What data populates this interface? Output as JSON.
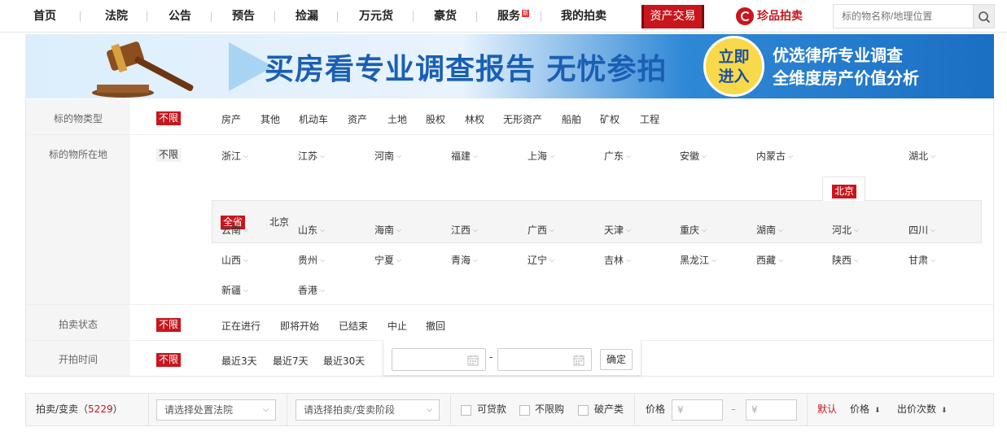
{
  "nav": {
    "items": [
      "首页",
      "法院",
      "公告",
      "预告",
      "捡漏",
      "万元货",
      "豪货",
      "服务",
      "我的拍卖"
    ],
    "hot_badge": "新",
    "asset_trade": "资产交易",
    "brand": "珍品拍卖",
    "search_placeholder": "标的物名称/地理位置"
  },
  "banner": {
    "main_text": "买房看专业调查报告 无忧参拍",
    "cta_line1": "立即",
    "cta_line2": "进入",
    "right_line1": "优选律所专业调查",
    "right_line2": "全维度房产价值分析"
  },
  "filters": {
    "unlimited_label": "不限",
    "type": {
      "label": "标的物类型",
      "options": [
        "房产",
        "其他",
        "机动车",
        "资产",
        "土地",
        "股权",
        "林权",
        "无形资产",
        "船舶",
        "矿权",
        "工程"
      ]
    },
    "location": {
      "label": "标的物所在地",
      "row1": [
        "浙江",
        "江苏",
        "河南",
        "福建",
        "上海",
        "广东",
        "安徽",
        "内蒙古",
        "北京",
        "湖北"
      ],
      "selected": "北京",
      "sub_all": "全省",
      "sub_options": [
        "北京"
      ],
      "row2": [
        "云南",
        "山东",
        "海南",
        "江西",
        "广西",
        "天津",
        "重庆",
        "湖南",
        "河北",
        "四川"
      ],
      "row3": [
        "山西",
        "贵州",
        "宁夏",
        "青海",
        "辽宁",
        "吉林",
        "黑龙江",
        "西藏",
        "陕西",
        "甘肃"
      ],
      "row4": [
        "新疆",
        "香港"
      ]
    },
    "status": {
      "label": "拍卖状态",
      "options": [
        "正在进行",
        "即将开始",
        "已结束",
        "中止",
        "撤回"
      ]
    },
    "start_time": {
      "label": "开拍时间",
      "options": [
        "最近3天",
        "最近7天",
        "最近30天"
      ],
      "dash": "-",
      "confirm": "确定"
    }
  },
  "sortbar": {
    "label_prefix": "拍卖/变卖（",
    "count": "5229",
    "label_suffix": "）",
    "court_select": "请选择处置法院",
    "stage_select": "请选择拍卖/变卖阶段",
    "checks": [
      "可贷款",
      "不限购",
      "破产类"
    ],
    "price_label": "价格",
    "price_min_placeholder": "¥",
    "price_dash": "–",
    "price_max_placeholder": "¥",
    "sort_default": "默认",
    "sort_price": "价格",
    "sort_bids": "出价次数"
  },
  "colors": {
    "accent": "#c8161d",
    "banner_blue": "#1a5fb4"
  }
}
